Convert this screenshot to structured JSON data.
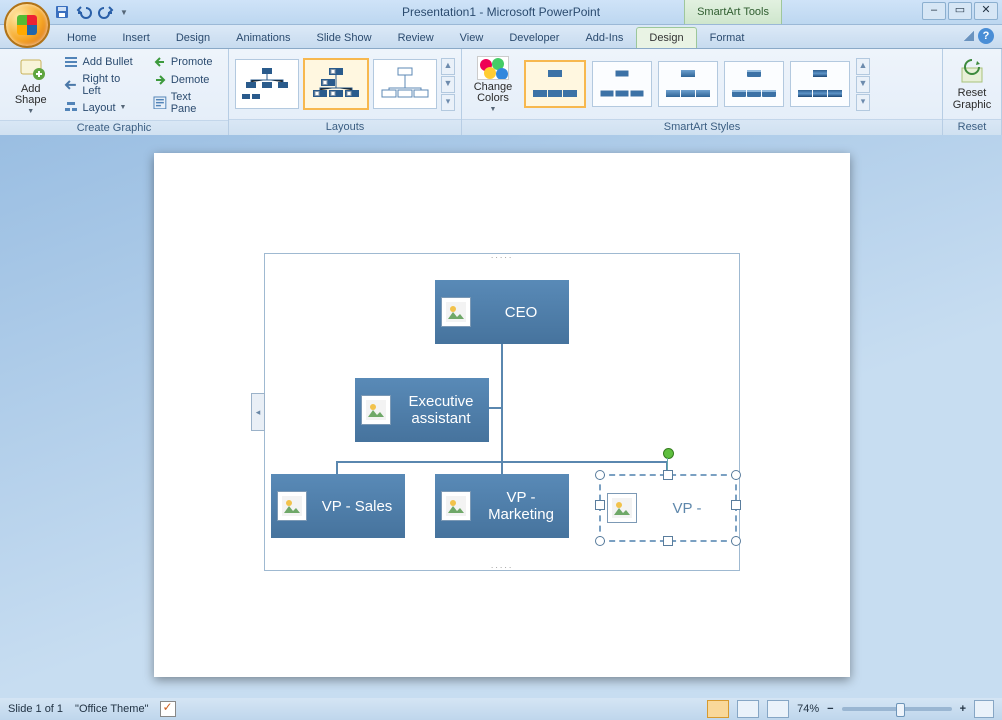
{
  "title": "Presentation1 - Microsoft PowerPoint",
  "contextual_title": "SmartArt Tools",
  "tabs": [
    "Home",
    "Insert",
    "Design",
    "Animations",
    "Slide Show",
    "Review",
    "View",
    "Developer",
    "Add-Ins",
    "Design",
    "Format"
  ],
  "active_tab_index": 9,
  "ribbon": {
    "add_shape": "Add Shape",
    "add_bullet": "Add Bullet",
    "right_to_left": "Right to Left",
    "layout": "Layout",
    "promote": "Promote",
    "demote": "Demote",
    "text_pane": "Text Pane",
    "create_graphic": "Create Graphic",
    "layouts": "Layouts",
    "change_colors": "Change Colors",
    "smartart_styles": "SmartArt Styles",
    "reset_graphic1": "Reset",
    "reset_graphic2": "Graphic",
    "reset": "Reset"
  },
  "org": {
    "ceo": "CEO",
    "ea": "Executive assistant",
    "vp_sales": "VP - Sales",
    "vp_marketing": "VP - Marketing",
    "vp_editing": "VP - "
  },
  "status": {
    "slide": "Slide 1 of 1",
    "theme": "\"Office Theme\"",
    "zoom": "74%"
  }
}
